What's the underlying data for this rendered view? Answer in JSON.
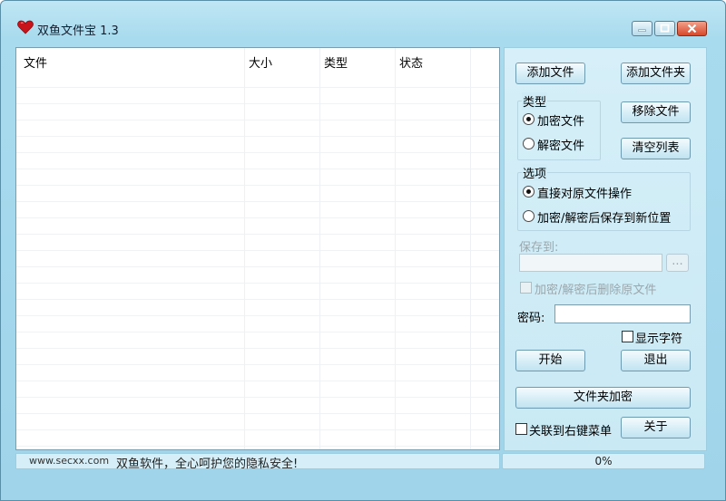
{
  "window": {
    "title": "双鱼文件宝 1.3"
  },
  "file_list": {
    "columns": [
      "文件",
      "大小",
      "类型",
      "状态"
    ]
  },
  "buttons": {
    "add_file": "添加文件",
    "add_folder": "添加文件夹",
    "remove_file": "移除文件",
    "clear_list": "清空列表",
    "start": "开始",
    "exit": "退出",
    "folder_encrypt": "文件夹加密",
    "about": "关于",
    "browse": "..."
  },
  "type_group": {
    "label": "类型",
    "encrypt": "加密文件",
    "decrypt": "解密文件",
    "selected": "encrypt"
  },
  "options_group": {
    "label": "选项",
    "direct": "直接对原文件操作",
    "save_new": "加密/解密后保存到新位置",
    "selected": "direct"
  },
  "save_to": {
    "label": "保存到:",
    "value": ""
  },
  "delete_original": {
    "label": "加密/解密后删除原文件",
    "checked": false
  },
  "password": {
    "label": "密码:",
    "value": ""
  },
  "show_chars": {
    "label": "显示字符",
    "checked": false
  },
  "associate_menu": {
    "label": "关联到右键菜单",
    "checked": false
  },
  "status": {
    "site": "www.secxx.com",
    "slogan": "双鱼软件，全心呵护您的隐私安全!"
  },
  "progress": {
    "percent": 0,
    "text": "0%"
  },
  "colors": {
    "accent": "#a9dbee",
    "close_button": "#d8482a"
  }
}
